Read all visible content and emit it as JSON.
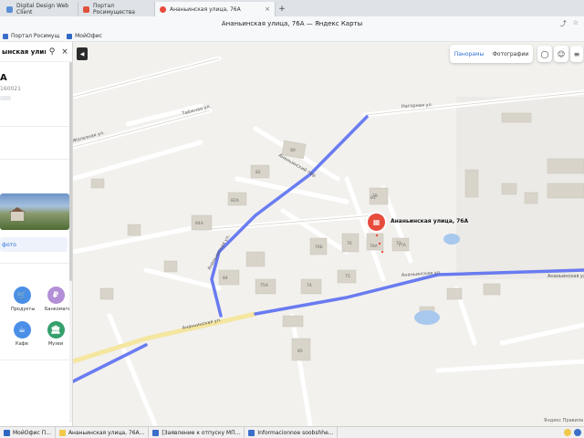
{
  "browser": {
    "tabs": [
      {
        "label": "Digital Design Web Client",
        "color": "#5a8fd6"
      },
      {
        "label": "Портал Росимущества",
        "color": "#e0503b"
      },
      {
        "label": "Ананьинская улица, 76А",
        "color": "#e74b3c"
      }
    ],
    "new_tab": "+",
    "title": "Ананьинская улица, 76А — Яндекс Карты",
    "bookmarks": [
      {
        "label": "Портал Росимущ",
        "color": "#3b6fc9"
      },
      {
        "label": "МойОфис",
        "color": "#2d68c4"
      }
    ]
  },
  "sidebar": {
    "search_value": "ынская улица, ул.",
    "title": "А",
    "zip": "160021",
    "photo_link": "фото",
    "categories": [
      {
        "label": "Продукты",
        "icon": "🛒",
        "color": "#4a8fe7"
      },
      {
        "label": "Банкоматы",
        "icon": "₽",
        "color": "#b38fd6"
      },
      {
        "label": "Кафе",
        "icon": "☕",
        "color": "#4a8fe7"
      },
      {
        "label": "Музеи",
        "icon": "🏛",
        "color": "#35a06c"
      }
    ]
  },
  "map": {
    "marker_label": "Ананьинская улица, 76А",
    "layers": {
      "panoramas": "Панорамы",
      "photos": "Фотографии"
    },
    "streets": {
      "north": "Нагорная ул.",
      "ananyinsky_per": "Ананьинский пер.",
      "ananyinsky_ul": "Ананьинская ул.",
      "ananyinsky_ul_right": "Ананьинская ул.",
      "taezhnaya": "Таёжная ул.",
      "zheleznaya": "Железная ул.",
      "sadovaya": "Ананьинская ул."
    },
    "houses": [
      "76А",
      "78",
      "76",
      "75",
      "74",
      "80",
      "82",
      "77А",
      "76Б",
      "75А",
      "82А",
      "84",
      "84А",
      "81",
      "85",
      "71"
    ],
    "attribution": "Яндекс Правила",
    "accent": "#5b6ff1",
    "marker_color": "#e74b3c"
  },
  "taskbar": {
    "items": [
      {
        "label": "МойОфис П...",
        "color": "#2d68c4"
      },
      {
        "label": "Ананьинская улица, 76А...",
        "color": "#f2c94c"
      },
      {
        "label": "[Заявление к отпуску МП...",
        "color": "#3b6fc9"
      },
      {
        "label": "Informacionnoe soobshhe...",
        "color": "#3b6fc9"
      }
    ]
  }
}
